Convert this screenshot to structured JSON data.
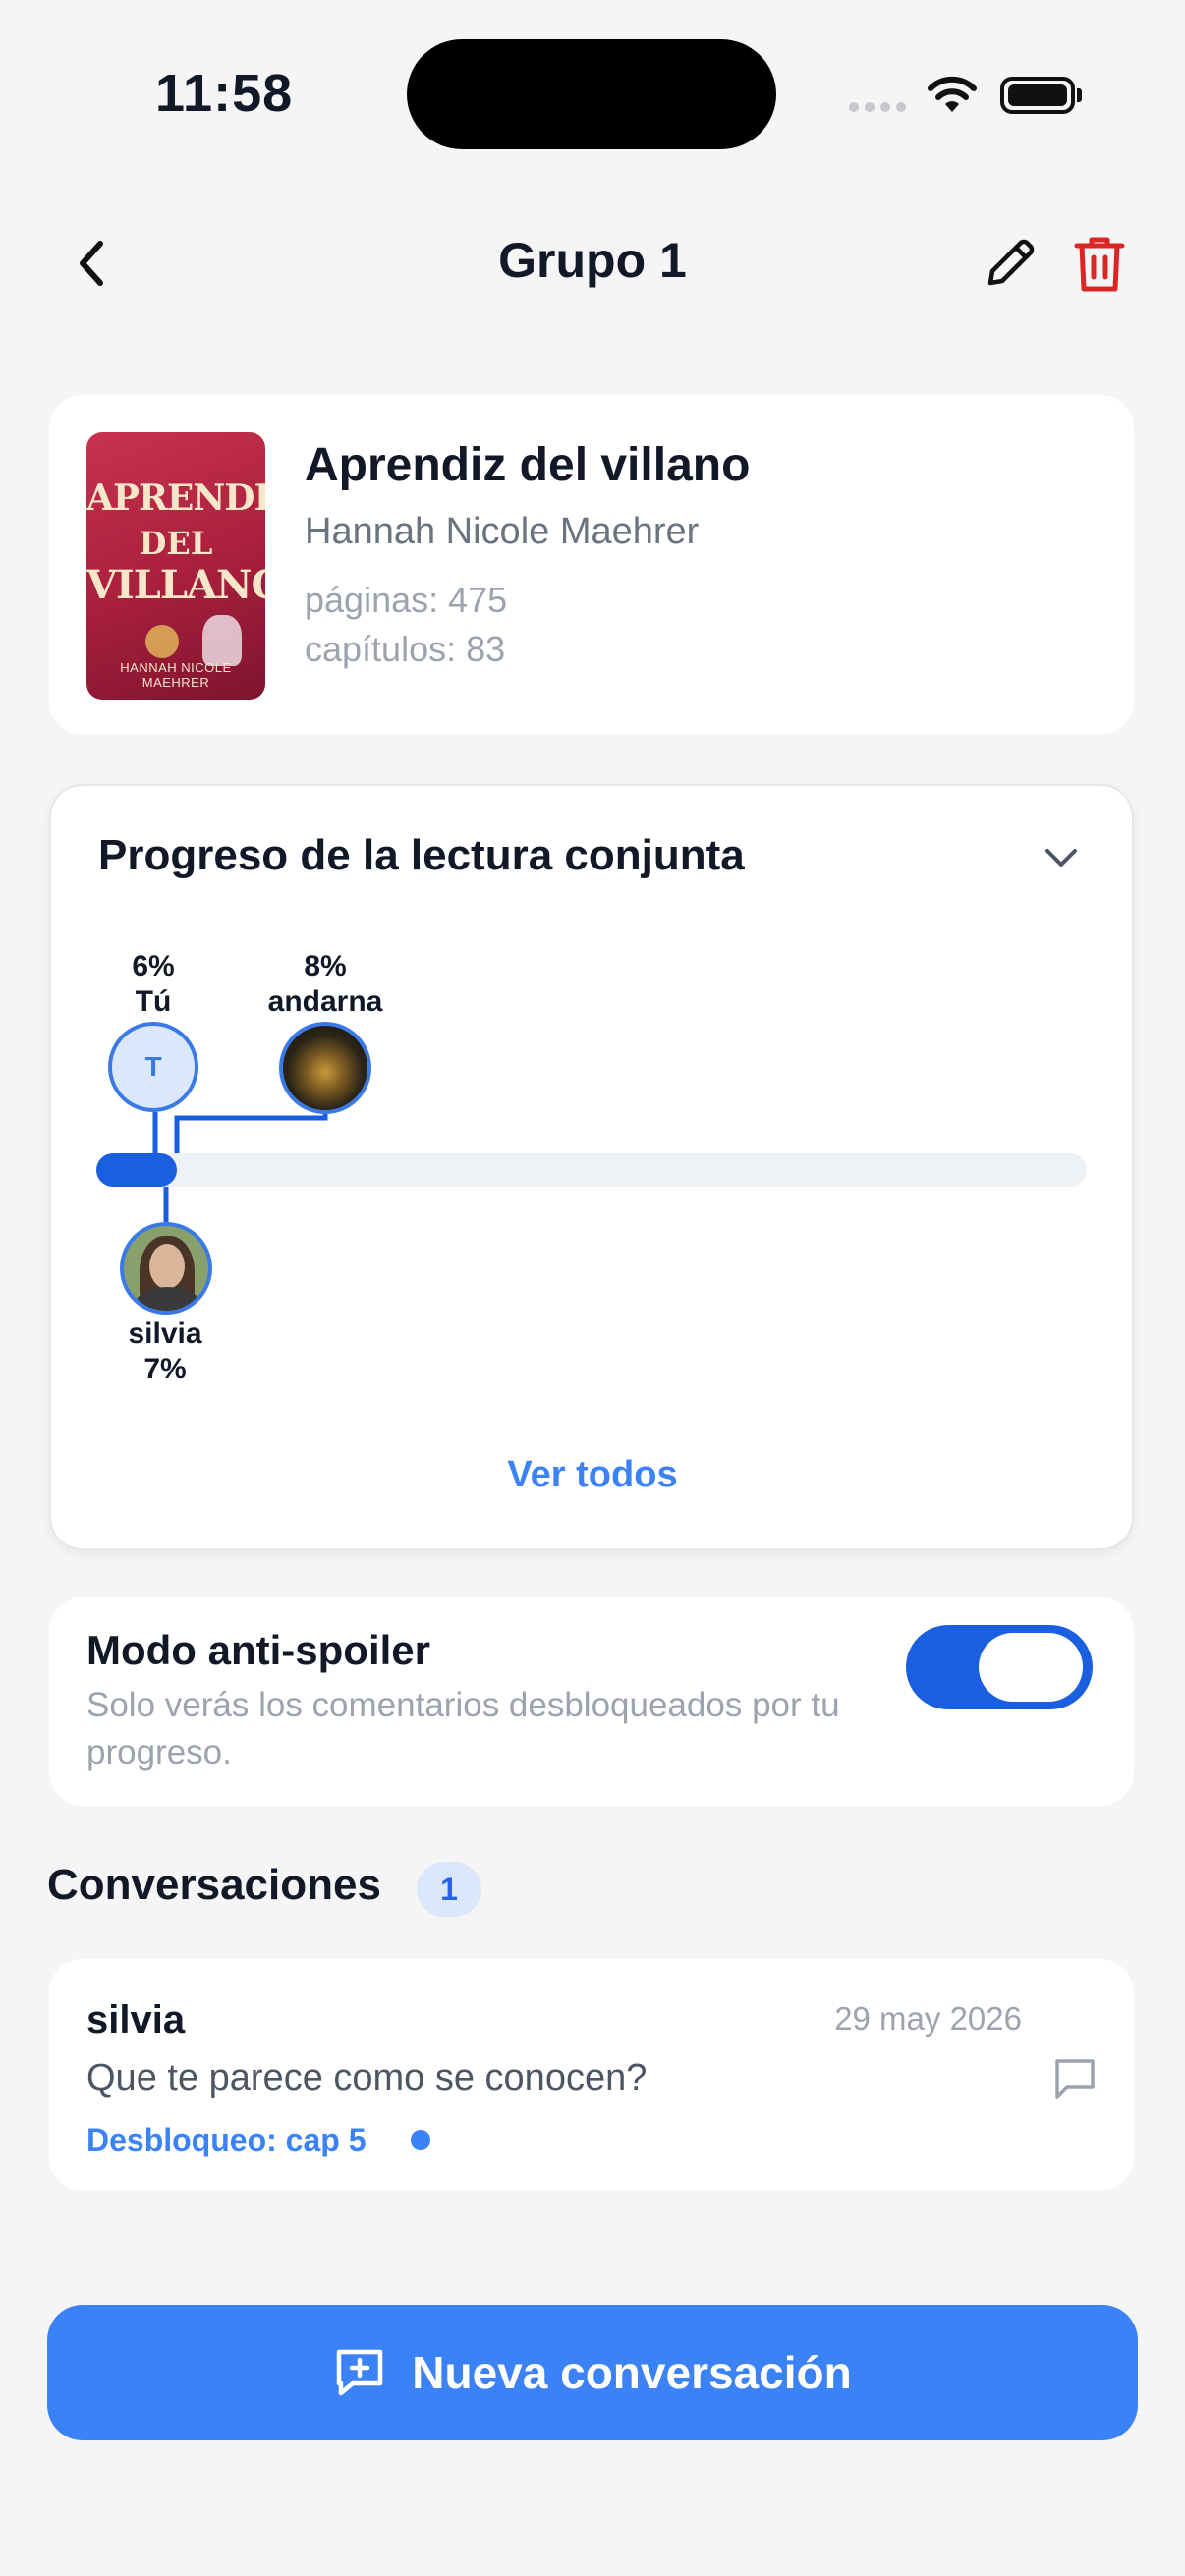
{
  "status_bar": {
    "time": "11:58"
  },
  "header": {
    "title": "Grupo 1"
  },
  "book": {
    "title": "Aprendiz del villano",
    "author": "Hannah Nicole Maehrer",
    "pages": "páginas: 475",
    "chapters": "capítulos: 83",
    "cover": {
      "line1": "APRENDIZ",
      "line2": "DEL",
      "line3": "VILLANO",
      "author_line": "HANNAH NICOLE MAEHRER"
    }
  },
  "progress": {
    "title": "Progreso de la lectura conjunta",
    "overall_fraction": 0.08,
    "members": [
      {
        "name": "Tú",
        "percent": "6%",
        "initial": "T"
      },
      {
        "name": "andarna",
        "percent": "8%"
      },
      {
        "name": "silvia",
        "percent": "7%"
      }
    ],
    "see_all": "Ver todos"
  },
  "anti_spoiler": {
    "title": "Modo anti-spoiler",
    "description": "Solo verás los comentarios desbloqueados por tu progreso.",
    "enabled": true
  },
  "conversations": {
    "heading": "Conversaciones",
    "count": "1",
    "items": [
      {
        "user": "silvia",
        "date": "29 may 2026",
        "text": "Que te parece como se conocen?",
        "unlock": "Desbloqueo: cap 5"
      }
    ]
  },
  "new_conversation": {
    "label": "Nueva conversación"
  },
  "colors": {
    "accent": "#3b82f6",
    "progress": "#1a5fe0",
    "danger": "#dc2626",
    "background": "#f5f5f6"
  }
}
